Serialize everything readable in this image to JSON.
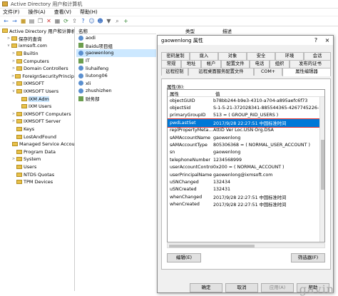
{
  "window": {
    "title": "Active Directory 用户和计算机"
  },
  "menu": [
    "文件(F)",
    "操作(A)",
    "查看(V)",
    "帮助(H)"
  ],
  "toolbar_icons": [
    "back-icon",
    "forward-icon",
    "folder-icon",
    "details-icon",
    "copy-icon",
    "delete-icon",
    "properties-icon",
    "refresh-icon",
    "export-icon",
    "help-icon",
    "user-icon",
    "group-icon",
    "filter-icon",
    "find-icon",
    "add-icon"
  ],
  "tree": [
    {
      "label": "Active Directory 用户和计算机",
      "indent": 0,
      "expander": ""
    },
    {
      "label": "保存的查询",
      "indent": 1,
      "expander": ">"
    },
    {
      "label": "ixmsoft.com",
      "indent": 1,
      "expander": "v"
    },
    {
      "label": "Builtin",
      "indent": 2,
      "expander": ">"
    },
    {
      "label": "Computers",
      "indent": 2,
      "expander": ">"
    },
    {
      "label": "Domain Controllers",
      "indent": 2,
      "expander": ">"
    },
    {
      "label": "ForeignSecurityPrincipa",
      "indent": 2,
      "expander": ">"
    },
    {
      "label": "IXMSOFT",
      "indent": 2,
      "expander": ">"
    },
    {
      "label": "IXMSOFT Users",
      "indent": 2,
      "expander": "v"
    },
    {
      "label": "IXM Adm",
      "indent": 3,
      "expander": "",
      "selected": true
    },
    {
      "label": "IXM Users",
      "indent": 3,
      "expander": ""
    },
    {
      "label": "IXMSOFT Computers",
      "indent": 2,
      "expander": ">"
    },
    {
      "label": "IXMSOFT Server",
      "indent": 2,
      "expander": ">"
    },
    {
      "label": "Keys",
      "indent": 2,
      "expander": ""
    },
    {
      "label": "LostAndFound",
      "indent": 2,
      "expander": ""
    },
    {
      "label": "Managed Service Accou",
      "indent": 2,
      "expander": ""
    },
    {
      "label": "Program Data",
      "indent": 2,
      "expander": ""
    },
    {
      "label": "System",
      "indent": 2,
      "expander": ">"
    },
    {
      "label": "Users",
      "indent": 2,
      "expander": ""
    },
    {
      "label": "NTDS Quotas",
      "indent": 2,
      "expander": ""
    },
    {
      "label": "TPM Devices",
      "indent": 2,
      "expander": ""
    }
  ],
  "list": {
    "header_name": "名称",
    "header_type": "类型",
    "header_desc": "描述",
    "items": [
      {
        "label": "aodi",
        "kind": "user"
      },
      {
        "label": "Baidu项目组",
        "kind": "group"
      },
      {
        "label": "gaowenlong",
        "kind": "user",
        "selected": true
      },
      {
        "label": "IT",
        "kind": "group"
      },
      {
        "label": "liuhaifeng",
        "kind": "user"
      },
      {
        "label": "liutong06",
        "kind": "user"
      },
      {
        "label": "xli",
        "kind": "user"
      },
      {
        "label": "zhushizhen",
        "kind": "user"
      },
      {
        "label": "财务部",
        "kind": "group"
      }
    ]
  },
  "dialog": {
    "title": "gaowenlong 属性",
    "help": "?",
    "close": "×",
    "tabs_row1": [
      "密码复制",
      "拨入",
      "对象",
      "安全",
      "环境",
      "会话"
    ],
    "tabs_row2": [
      "常规",
      "地址",
      "帐户",
      "配置文件",
      "电话",
      "组织",
      "发布的证书"
    ],
    "tabs_row3": [
      "远程控制",
      "远程桌面服务配置文件",
      "COM+",
      "属性编辑器"
    ],
    "attributes_label": "属性(B):",
    "col_attr": "属性",
    "col_value": "值",
    "rows": [
      {
        "name": "objectGUID",
        "value": "b78bb244-b9e3-4310-a704-a895aefc6f73"
      },
      {
        "name": "objectSid",
        "value": "S-1-5-21-372028341-885544365-4267745226-1"
      },
      {
        "name": "primaryGroupID",
        "value": "513 = ( GROUP_RID_USERS )"
      },
      {
        "name": "pwdLastSet",
        "value": "2017/9/28 22:27:51 中国标准时间",
        "selected": true
      },
      {
        "name": "replPropertyMeta...",
        "value": "AttID  Ver   Loc.USN          Org.DSA"
      },
      {
        "name": "sAMAccountName",
        "value": "gaowenlong"
      },
      {
        "name": "sAMAccountType",
        "value": "805306368 = ( NORMAL_USER_ACCOUNT )"
      },
      {
        "name": "sn",
        "value": "gaowenlong"
      },
      {
        "name": "telephoneNumber",
        "value": "1234568999"
      },
      {
        "name": "userAccountControl",
        "value": "0x200 = ( NORMAL_ACCOUNT )"
      },
      {
        "name": "userPrincipalName",
        "value": "gaowenlong@ixmsoft.com"
      },
      {
        "name": "uSNChanged",
        "value": "132434"
      },
      {
        "name": "uSNCreated",
        "value": "132431"
      },
      {
        "name": "whenChanged",
        "value": "2017/9/28 22:27:51 中国标准时间"
      },
      {
        "name": "whenCreated",
        "value": "2017/9/28 22:27:51 中国标准时间"
      }
    ],
    "edit_button": "编辑(E)",
    "filter_button": "筛选器(F)",
    "ok_button": "确定",
    "cancel_button": "取消",
    "apply_button": "应用(A)",
    "help_button": "帮助"
  },
  "watermark": "gavin"
}
